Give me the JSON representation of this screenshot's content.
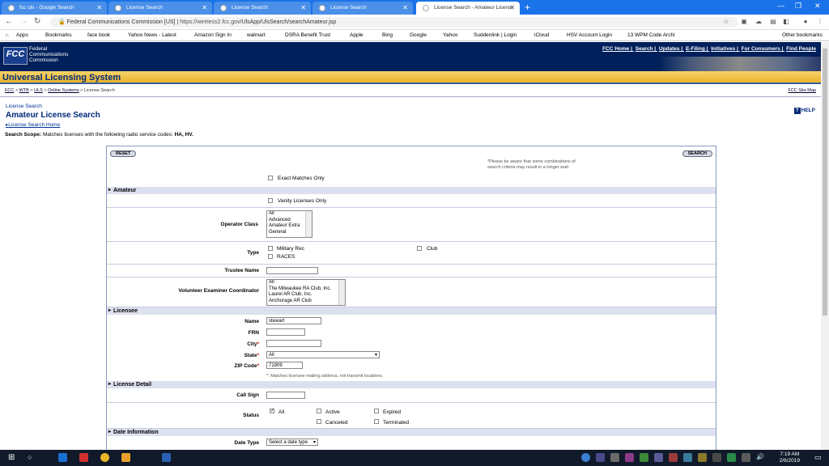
{
  "browser": {
    "tabs": [
      {
        "label": "fcc uls - Google Search",
        "active": false
      },
      {
        "label": "License Search",
        "active": false
      },
      {
        "label": "License Search",
        "active": false
      },
      {
        "label": "License Search",
        "active": false
      },
      {
        "label": "License Search - Amateur Licens",
        "active": true
      }
    ],
    "new_tab": "+",
    "controls": {
      "minimize": "—",
      "maximize": "❐",
      "close": "✕"
    },
    "site_name": "Federal Communications Commission [US]",
    "url_host": "https://wireless2.fcc.gov",
    "url_path": "/UlsApp/UlsSearch/searchAmateur.jsp",
    "bookmarks": [
      "Apps",
      "Bookmarks",
      "face book",
      "Yahoo News - Latest",
      "Amazon Sign In",
      "walmart",
      "DSRA Benefit Trust",
      "Apple",
      "Bing",
      "Google",
      "Yahoo",
      "Suddenlink | Login",
      "iCloud",
      "HSV Account Login",
      "13 WPM Code Archi"
    ],
    "other_bookmarks": "Other bookmarks"
  },
  "fcc": {
    "logo": "FCC",
    "logo_text": [
      "Federal",
      "Communications",
      "Commission"
    ],
    "top_links": [
      "FCC Home",
      "Search",
      "Updates",
      "E-Filing",
      "Initiatives",
      "For Consumers",
      "Find People"
    ],
    "system_title": "Universal Licensing System",
    "breadcrumb": [
      "FCC",
      "WTB",
      "ULS",
      "Online Systems",
      "License Search"
    ],
    "site_map": "FCC Site Map",
    "page_small_title": "License Search",
    "page_title": "Amateur License Search",
    "home_link": "License Search Home",
    "help": "HELP",
    "scope_label": "Search Scope:",
    "scope_text": "Matches licenses with the following radio service codes:",
    "scope_codes": "HA, HV."
  },
  "form": {
    "reset": "RESET",
    "search": "SEARCH",
    "wait_note": [
      "*Please be aware that some combinations of",
      "search criteria may result in a longer wait."
    ],
    "exact_matches": "Exact Matches Only",
    "sections": {
      "amateur": "Amateur",
      "licensee": "Licensee",
      "license_detail": "License Detail",
      "date_information": "Date Information"
    },
    "vanity": "Vanity Licenses Only",
    "operator_class_label": "Operator Class",
    "operator_class_options": [
      "All",
      "Advanced",
      "Amateur Extra",
      "General"
    ],
    "type_label": "Type",
    "type_options": {
      "military": "Military Rec",
      "club": "Club",
      "races": "RACES"
    },
    "trustee_label": "Trustee Name",
    "vec_label": "Volunteer Examiner Coordinator",
    "vec_options": [
      "All",
      "The Milwaukee RA Club, Inc.",
      "Laurel AR Club, Inc.",
      "Anchorage AR Club"
    ],
    "name_label": "Name",
    "name_value": "stewart",
    "frn_label": "FRN",
    "city_label": "City",
    "state_label": "State",
    "state_value": "All",
    "zip_label": "ZIP Code",
    "zip_value": "71909",
    "asterisk": "*",
    "mailing_note": "*: Matches licensee mailing address, not transmit locations.",
    "call_sign_label": "Call Sign",
    "status_label": "Status",
    "status_options": {
      "all": "All",
      "active": "Active",
      "expired": "Expired",
      "canceled": "Canceled",
      "terminated": "Terminated"
    },
    "date_type_label": "Date Type",
    "date_type_value": "Select a date type"
  },
  "taskbar": {
    "time": "7:19 AM",
    "date": "2/6/2019"
  }
}
